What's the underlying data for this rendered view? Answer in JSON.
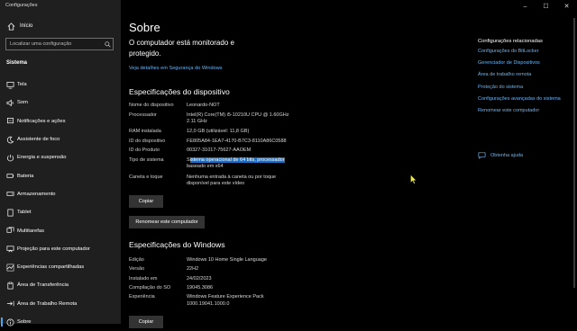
{
  "app": {
    "title": "Configurações"
  },
  "sidebar": {
    "home_label": "Início",
    "search_placeholder": "Localizar uma configuração",
    "section": "Sistema",
    "items": [
      {
        "label": "Tela",
        "icon": "display-icon"
      },
      {
        "label": "Som",
        "icon": "speaker-icon"
      },
      {
        "label": "Notificações e ações",
        "icon": "notification-icon"
      },
      {
        "label": "Assistente de foco",
        "icon": "moon-icon"
      },
      {
        "label": "Energia e suspensão",
        "icon": "power-icon"
      },
      {
        "label": "Bateria",
        "icon": "battery-icon"
      },
      {
        "label": "Armazenamento",
        "icon": "storage-icon"
      },
      {
        "label": "Tablet",
        "icon": "tablet-icon"
      },
      {
        "label": "Multitarefas",
        "icon": "multitask-icon"
      },
      {
        "label": "Projeção para este computador",
        "icon": "projection-icon"
      },
      {
        "label": "Experiências compartilhadas",
        "icon": "shared-icon"
      },
      {
        "label": "Área de Transferência",
        "icon": "clipboard-icon"
      },
      {
        "label": "Área de Trabalho Remota",
        "icon": "remote-icon"
      },
      {
        "label": "Sobre",
        "icon": "info-icon",
        "selected": true
      }
    ]
  },
  "window_controls": {
    "minimize": "–",
    "maximize": "☐",
    "close": "✕"
  },
  "main": {
    "title": "Sobre",
    "status": "O computador está monitorado e protegido.",
    "security_link": "Veja detalhes em Segurança do Windows",
    "device_heading": "Especificações do dispositivo",
    "device_specs": [
      {
        "key": "Nome do dispositivo",
        "value": "Leonardo-NOT"
      },
      {
        "key": "Processador",
        "value": "Intel(R) Core(TM) i5-10210U CPU @ 1.60GHz 2.11 GHz"
      },
      {
        "key": "RAM instalada",
        "value": "12,0 GB (utilizável: 11,8 GB)"
      },
      {
        "key": "ID do dispositivo",
        "value": "FE805A84-1EA7-4170-B7C3-8110A86C0588"
      },
      {
        "key": "ID do Produto",
        "value": "00327-31017-75627-AAOEM"
      },
      {
        "key": "Tipo de sistema",
        "value_pre": "S",
        "value_hl": "istema operacional de 64 bits, processador",
        "value_post": " baseado em x64"
      },
      {
        "key": "Caneta e toque",
        "value": "Nenhuma entrada à caneta ou por toque disponível para este vídeo"
      }
    ],
    "copy_label": "Copiar",
    "rename_label": "Renomear este computador",
    "windows_heading": "Especificações do Windows",
    "windows_specs": [
      {
        "key": "Edição",
        "value": "Windows 10 Home Single Language"
      },
      {
        "key": "Versão",
        "value": "22H2"
      },
      {
        "key": "Instalado em",
        "value": "24/02/2023"
      },
      {
        "key": "Compilação do SO",
        "value": "19045.3086"
      },
      {
        "key": "Experiência",
        "value": "Windows Feature Experience Pack 1000.19041.1000.0"
      }
    ],
    "copy2_label": "Copiar"
  },
  "related": {
    "title": "Configurações relacionadas",
    "links": [
      "Configurações do BitLocker",
      "Gerenciador de Dispositivos",
      "Área de trabalho remota",
      "Proteção do sistema",
      "Configurações avançadas do sistema",
      "Renomear este computador"
    ],
    "help": "Obtenha ajuda"
  },
  "colors": {
    "accent": "#4ca3e6",
    "link": "#6db4f0",
    "sidebar_bg": "#1f1f1f",
    "highlight": "#1a6fc4"
  }
}
